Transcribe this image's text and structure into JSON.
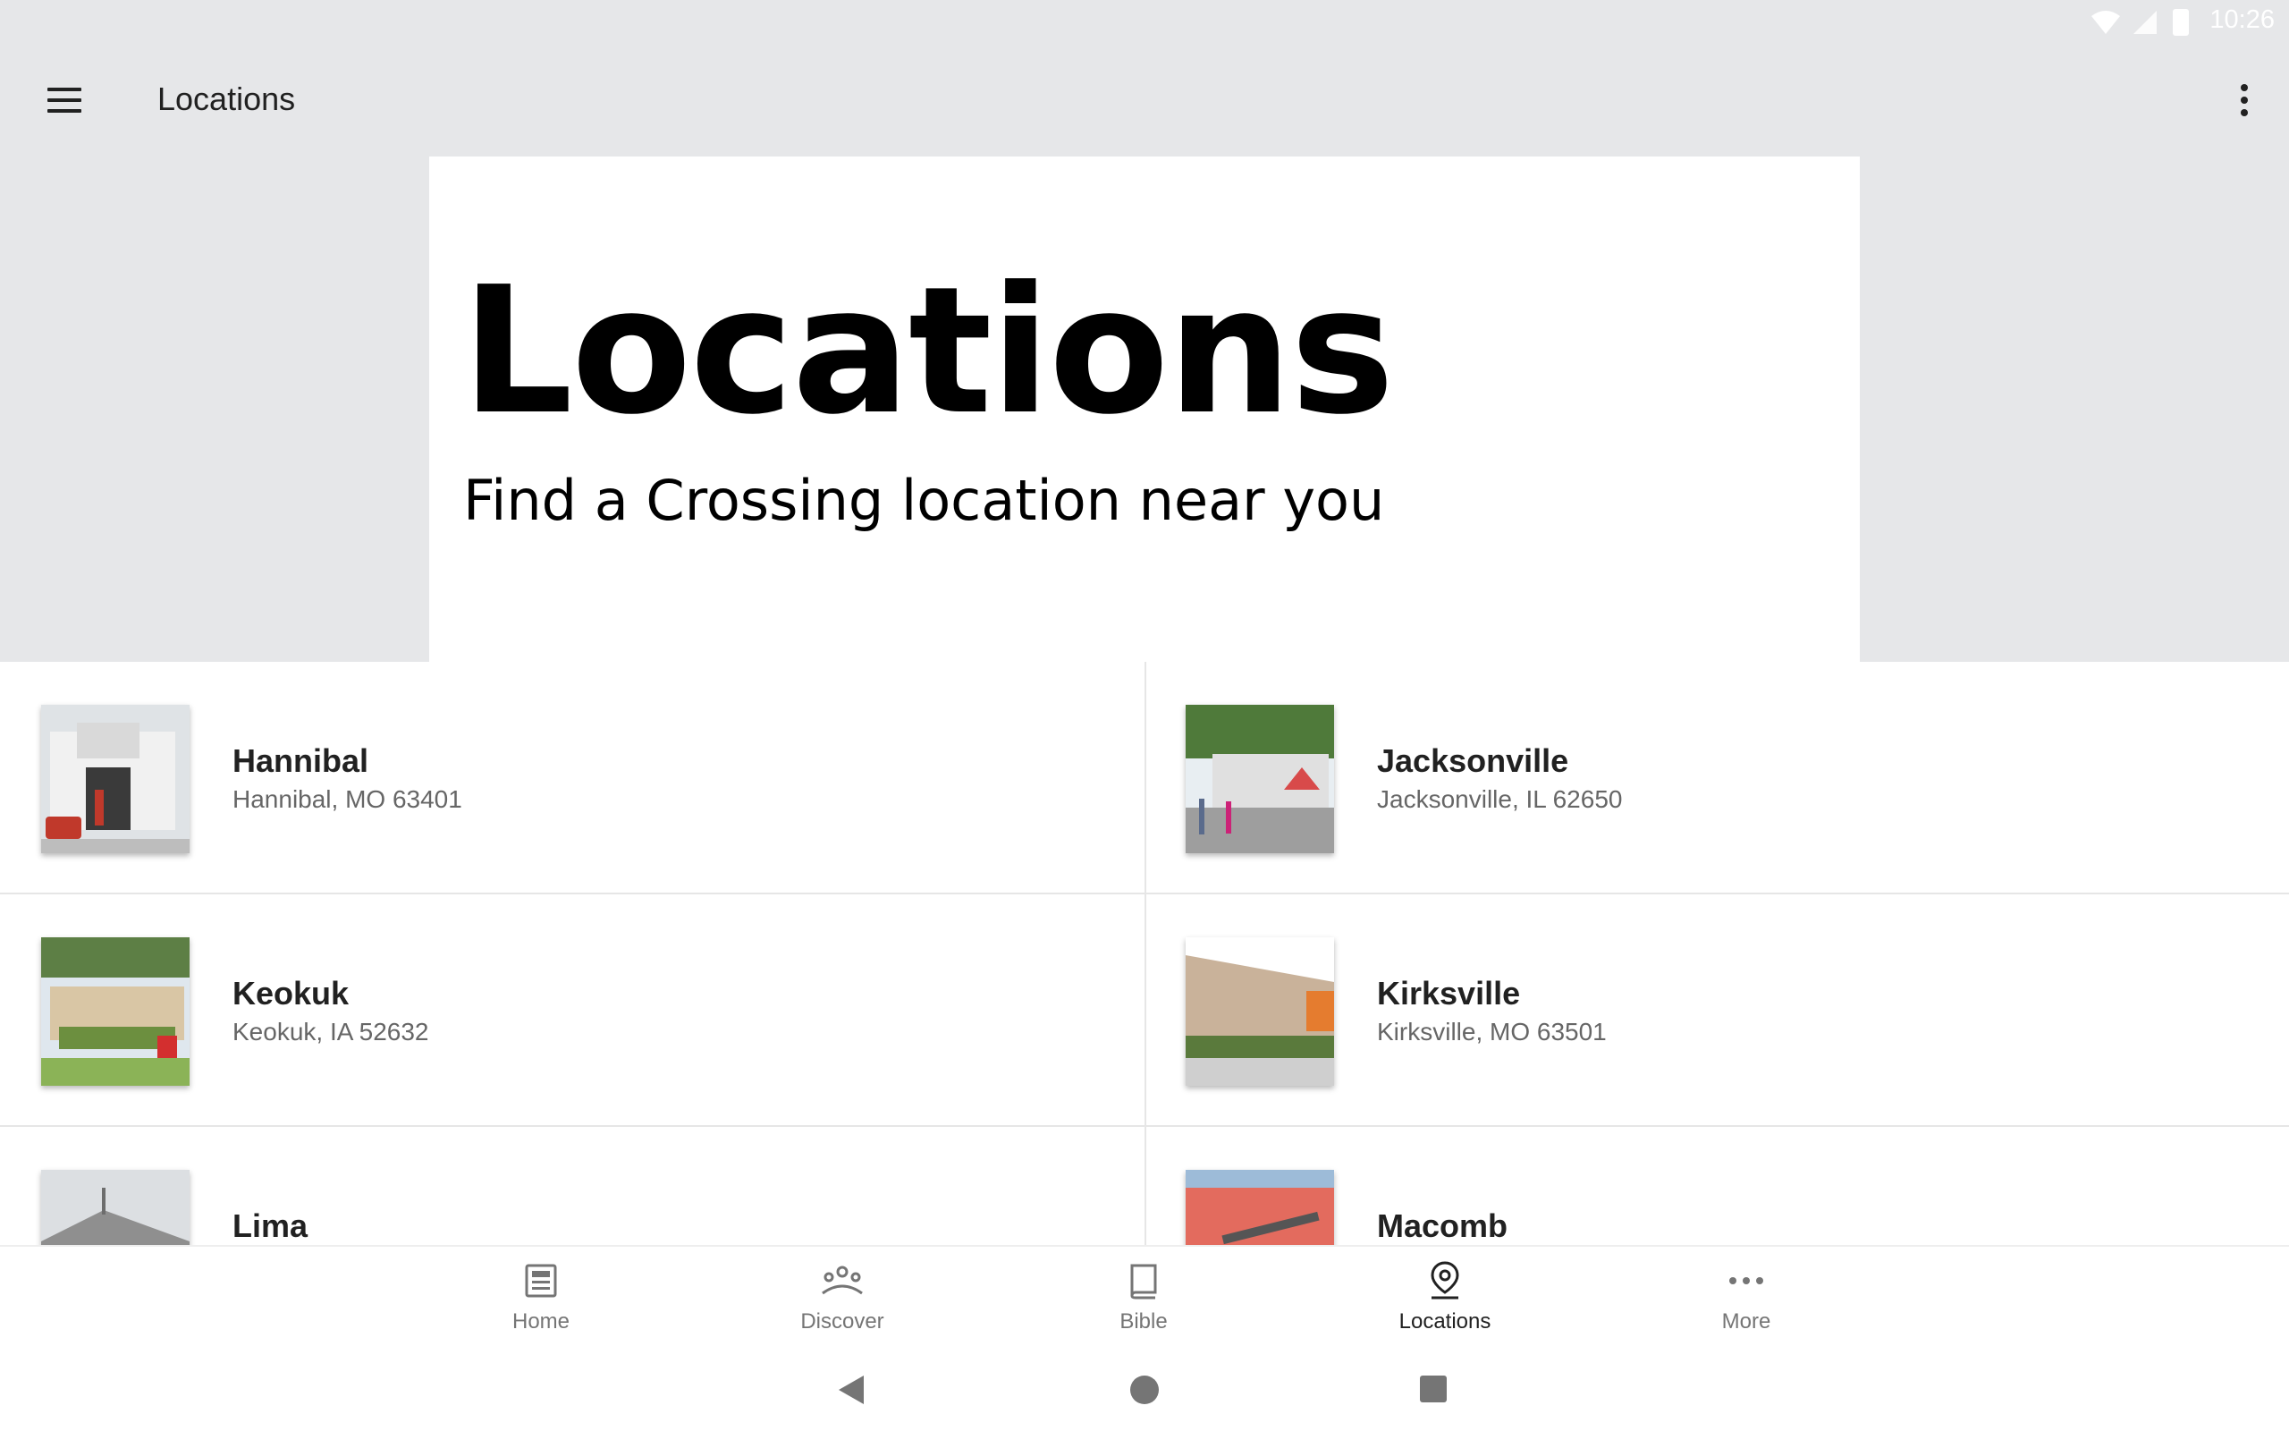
{
  "status_bar": {
    "time": "10:26"
  },
  "app_bar": {
    "title": "Locations"
  },
  "hero": {
    "title": "Locations",
    "subtitle": "Find a Crossing location near you"
  },
  "locations": [
    {
      "name": "Hannibal",
      "address": "Hannibal, MO 63401"
    },
    {
      "name": "Jacksonville",
      "address": "Jacksonville, IL 62650"
    },
    {
      "name": "Keokuk",
      "address": "Keokuk, IA 52632"
    },
    {
      "name": "Kirksville",
      "address": "Kirksville, MO 63501"
    },
    {
      "name": "Lima",
      "address": ""
    },
    {
      "name": "Macomb",
      "address": ""
    }
  ],
  "bottom_nav": {
    "items": [
      {
        "label": "Home",
        "icon": "newspaper-icon"
      },
      {
        "label": "Discover",
        "icon": "people-group-icon"
      },
      {
        "label": "Bible",
        "icon": "book-icon"
      },
      {
        "label": "Locations",
        "icon": "map-pin-icon",
        "active": true
      },
      {
        "label": "More",
        "icon": "more-horizontal-icon"
      }
    ]
  },
  "colors": {
    "app_bar_bg": "#e6e7e9",
    "text_primary": "#212121",
    "text_secondary": "#666666",
    "nav_inactive": "#757575"
  }
}
